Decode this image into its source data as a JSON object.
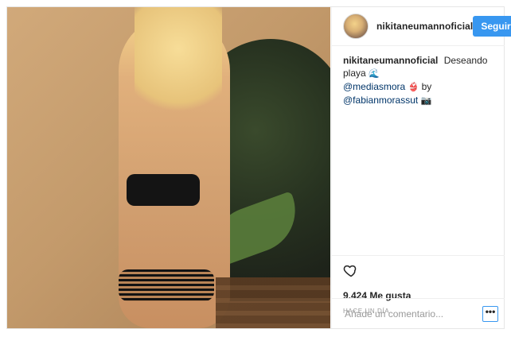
{
  "post": {
    "username": "nikitaneumannoficial",
    "follow_label": "Seguir",
    "caption": {
      "user": "nikitaneumannoficial",
      "text1": "Deseando playa",
      "emoji1": "🌊",
      "mention1": "@mediasmora",
      "emoji2": "👙",
      "by": "by",
      "mention2": "@fabianmorassut",
      "emoji3": "📷"
    },
    "likes": "9.424 Me gusta",
    "time": "HACE UN DÍA",
    "comment_placeholder": "Añade un comentario...",
    "more_label": "•••"
  },
  "colors": {
    "accent": "#3897f0",
    "text": "#262626",
    "muted": "#999999",
    "border": "#efefef"
  },
  "icons": {
    "like": "heart-icon",
    "avatar": "avatar"
  }
}
